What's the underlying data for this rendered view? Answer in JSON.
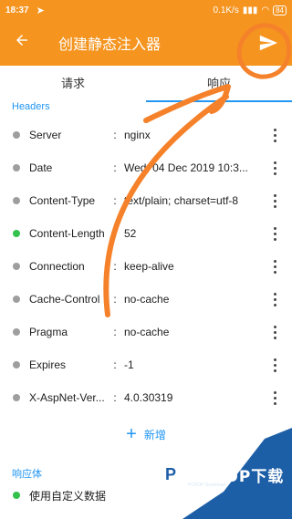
{
  "status_bar": {
    "time": "18:37",
    "speed": "0.1K/s",
    "battery": "84"
  },
  "app_bar": {
    "title": "创建静态注入器"
  },
  "tabs": [
    {
      "label": "请求",
      "active": false
    },
    {
      "label": "响应",
      "active": true
    }
  ],
  "headers_section": {
    "label": "Headers",
    "items": [
      {
        "name": "Server",
        "value": "nginx",
        "status": "gray"
      },
      {
        "name": "Date",
        "value": "Wed, 04 Dec 2019 10:3...",
        "status": "gray"
      },
      {
        "name": "Content-Type",
        "value": "text/plain; charset=utf-8",
        "status": "gray"
      },
      {
        "name": "Content-Length",
        "value": "52",
        "status": "green"
      },
      {
        "name": "Connection",
        "value": "keep-alive",
        "status": "gray"
      },
      {
        "name": "Cache-Control",
        "value": "no-cache",
        "status": "gray"
      },
      {
        "name": "Pragma",
        "value": "no-cache",
        "status": "gray"
      },
      {
        "name": "Expires",
        "value": "-1",
        "status": "gray"
      },
      {
        "name": "X-AspNet-Ver...",
        "value": "4.0.30319",
        "status": "gray"
      }
    ],
    "separator": ":",
    "add_label": "新增"
  },
  "body_section": {
    "label": "响应体",
    "option": "使用自定义数据"
  },
  "watermark": {
    "text": "PCPOP下载",
    "sub": "PCPOP Download"
  },
  "colors": {
    "brand": "#f5941f",
    "accent": "#2196f3",
    "active_dot": "#33c24d",
    "inactive_dot": "#9e9e9e"
  }
}
